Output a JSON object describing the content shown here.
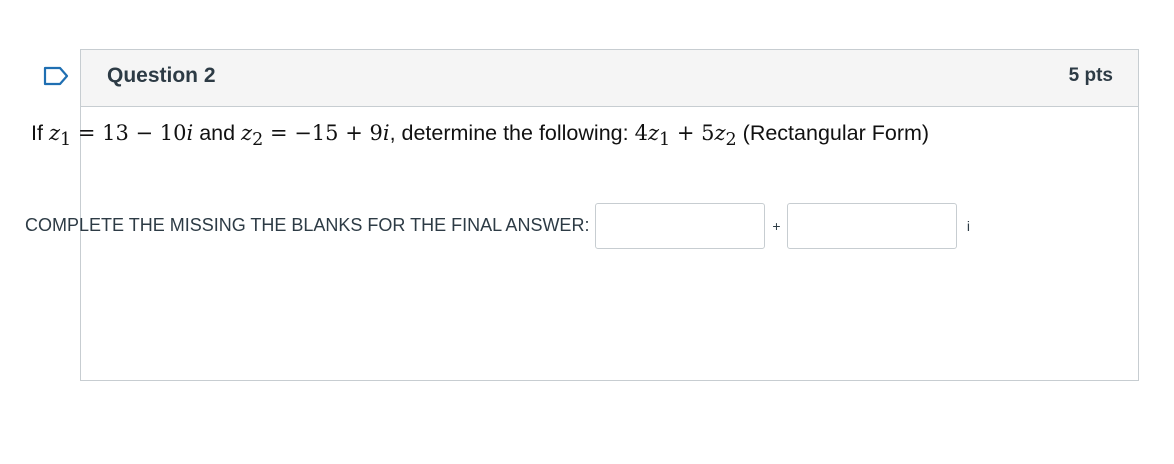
{
  "question": {
    "title": "Question 2",
    "points": "5 pts",
    "text": {
      "prefix": "If",
      "z1_var": "z",
      "z1_sub": "1",
      "z1_expr": " = 13 − 10",
      "z1_i": "i",
      "mid1": " and ",
      "z2_var": "z",
      "z2_sub": "2",
      "z2_expr": " = −15 + 9",
      "z2_i": "i",
      "mid2": ", determine the following: ",
      "expr_4": "4",
      "expr_z1": "z",
      "expr_z1_sub": "1",
      "expr_plus": " + 5",
      "expr_z2": "z",
      "expr_z2_sub": "2",
      "suffix": " (Rectangular Form)"
    },
    "answer": {
      "label": "COMPLETE THE MISSING THE BLANKS FOR THE FINAL ANSWER:",
      "real_value": "",
      "separator": "+",
      "imag_value": "",
      "imag_unit": "i"
    }
  },
  "icons": {
    "flag": "bookmark-flag-icon",
    "flag_color": "#1f6fb2"
  }
}
